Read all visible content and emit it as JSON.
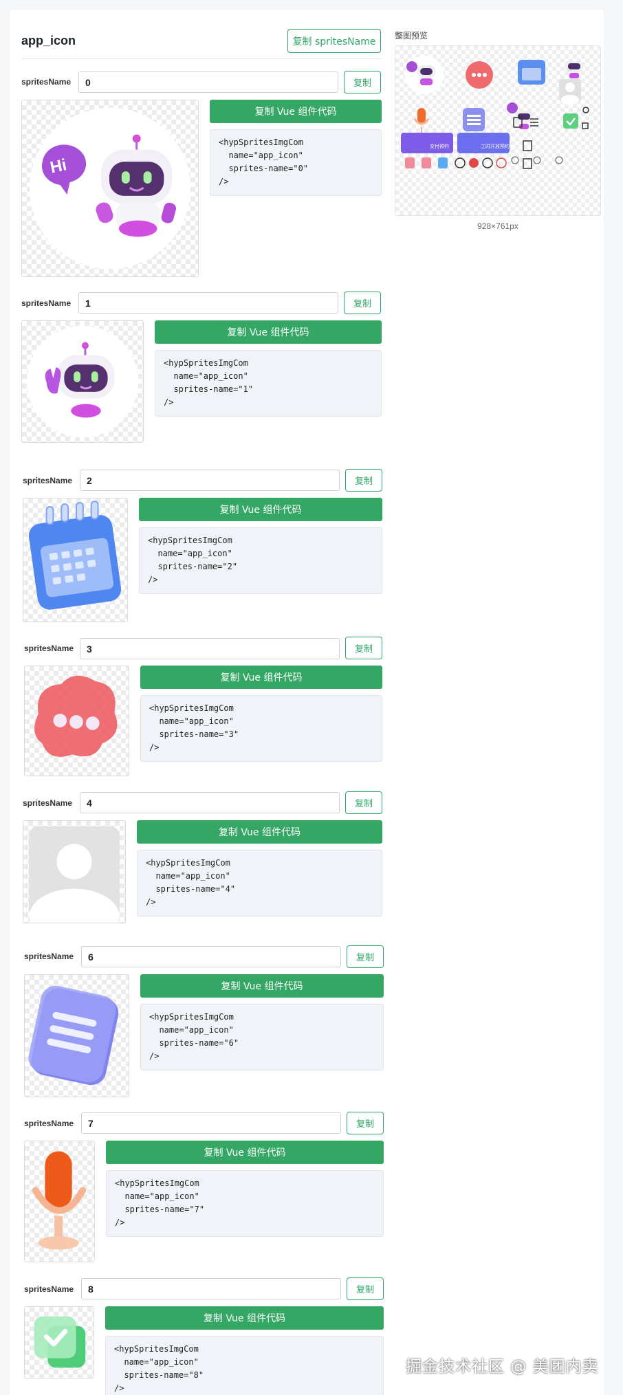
{
  "page": {
    "title": "app_icon",
    "copy_sprites_name_label": "复制 spritesName",
    "preview_label": "整图预览",
    "preview_size": "928×761px",
    "watermark": "掘金技术社区 @ 美团内卖"
  },
  "preview_sheet": {
    "button_texts": [
      "交付预约",
      "工时开放预约"
    ]
  },
  "rows": [
    {
      "label": "spritesName",
      "value": "0",
      "copy_label": "复制",
      "vue_label": "复制 Vue 组件代码",
      "code": "<hypSpritesImgCom\n  name=\"app_icon\"\n  sprites-name=\"0\"\n/>",
      "icon": "robot-hi-icon"
    },
    {
      "label": "spritesName",
      "value": "1",
      "copy_label": "复制",
      "vue_label": "复制 Vue 组件代码",
      "code": "<hypSpritesImgCom\n  name=\"app_icon\"\n  sprites-name=\"1\"\n/>",
      "icon": "robot-wave-icon"
    },
    {
      "label": "spritesName",
      "value": "2",
      "copy_label": "复制",
      "vue_label": "复制 Vue 组件代码",
      "code": "<hypSpritesImgCom\n  name=\"app_icon\"\n  sprites-name=\"2\"\n/>",
      "icon": "calendar-icon"
    },
    {
      "label": "spritesName",
      "value": "3",
      "copy_label": "复制",
      "vue_label": "复制 Vue 组件代码",
      "code": "<hypSpritesImgCom\n  name=\"app_icon\"\n  sprites-name=\"3\"\n/>",
      "icon": "chat-bubble-icon"
    },
    {
      "label": "spritesName",
      "value": "4",
      "copy_label": "复制",
      "vue_label": "复制 Vue 组件代码",
      "code": "<hypSpritesImgCom\n  name=\"app_icon\"\n  sprites-name=\"4\"\n/>",
      "icon": "avatar-placeholder-icon"
    },
    {
      "label": "spritesName",
      "value": "6",
      "copy_label": "复制",
      "vue_label": "复制 Vue 组件代码",
      "code": "<hypSpritesImgCom\n  name=\"app_icon\"\n  sprites-name=\"6\"\n/>",
      "icon": "document-icon"
    },
    {
      "label": "spritesName",
      "value": "7",
      "copy_label": "复制",
      "vue_label": "复制 Vue 组件代码",
      "code": "<hypSpritesImgCom\n  name=\"app_icon\"\n  sprites-name=\"7\"\n/>",
      "icon": "microphone-icon"
    },
    {
      "label": "spritesName",
      "value": "8",
      "copy_label": "复制",
      "vue_label": "复制 Vue 组件代码",
      "code": "<hypSpritesImgCom\n  name=\"app_icon\"\n  sprites-name=\"8\"\n/>",
      "icon": "check-card-icon"
    }
  ]
}
